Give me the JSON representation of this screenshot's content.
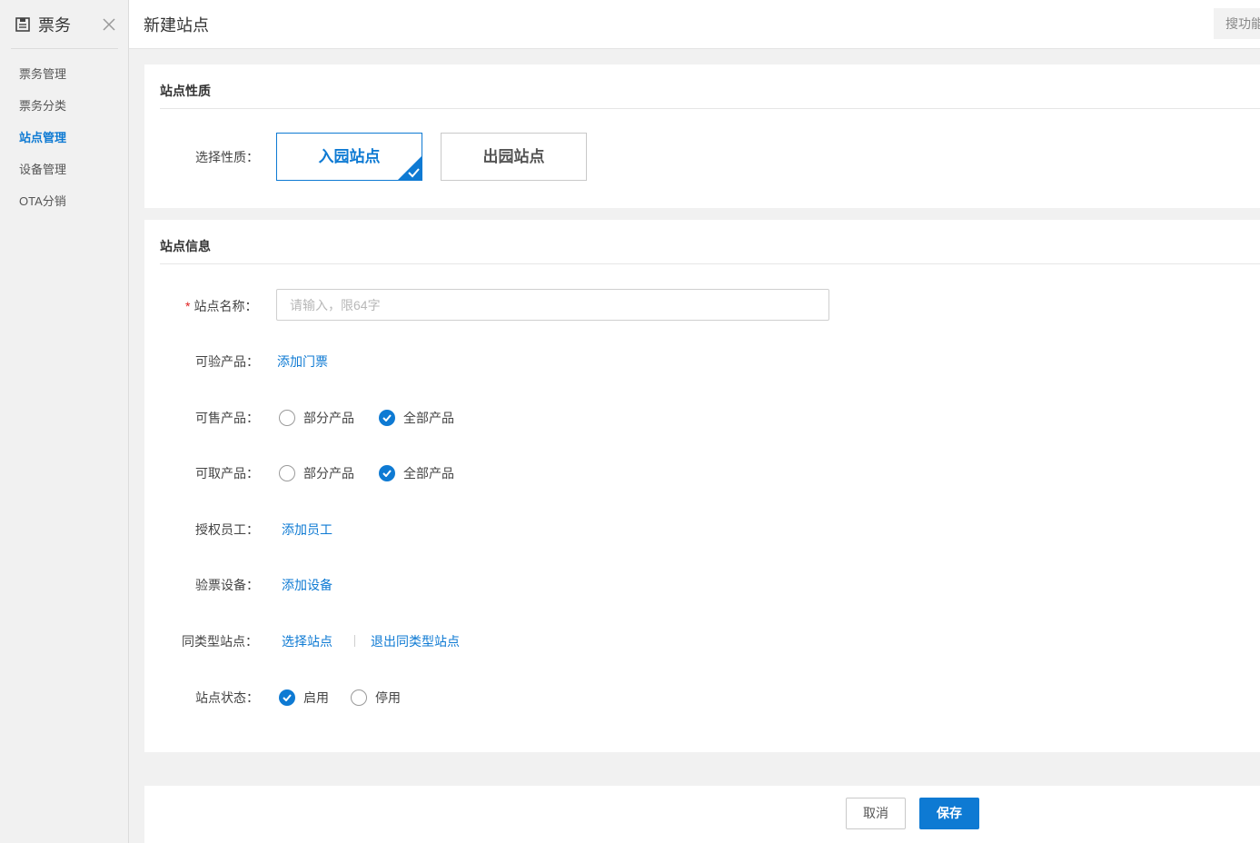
{
  "sidebar": {
    "title": "票务",
    "items": [
      {
        "label": "票务管理"
      },
      {
        "label": "票务分类"
      },
      {
        "label": "站点管理"
      },
      {
        "label": "设备管理"
      },
      {
        "label": "OTA分销"
      }
    ],
    "active_index": 2
  },
  "header": {
    "title": "新建站点",
    "search_placeholder": "搜功能"
  },
  "section_type": {
    "title": "站点性质",
    "label": "选择性质：",
    "options": [
      "入园站点",
      "出园站点"
    ],
    "selected": "入园站点"
  },
  "section_info": {
    "title": "站点信息",
    "name_label": "站点名称：",
    "name_required": "*",
    "name_placeholder": "请输入，限64字",
    "name_value": "",
    "verify_label": "可验产品：",
    "verify_link": "添加门票",
    "sell_label": "可售产品：",
    "sell_options": [
      "部分产品",
      "全部产品"
    ],
    "sell_selected": "全部产品",
    "pickup_label": "可取产品：",
    "pickup_options": [
      "部分产品",
      "全部产品"
    ],
    "pickup_selected": "全部产品",
    "staff_label": "授权员工：",
    "staff_link": "添加员工",
    "device_label": "验票设备：",
    "device_link": "添加设备",
    "same_type_label": "同类型站点：",
    "same_type_links": [
      "选择站点",
      "退出同类型站点"
    ],
    "status_label": "站点状态：",
    "status_options": [
      "启用",
      "停用"
    ],
    "status_selected": "启用"
  },
  "footer": {
    "cancel_label": "取消",
    "save_label": "保存"
  },
  "colors": {
    "accent": "#0e7ad3",
    "required": "#e02020",
    "background": "#f1f1f1"
  }
}
